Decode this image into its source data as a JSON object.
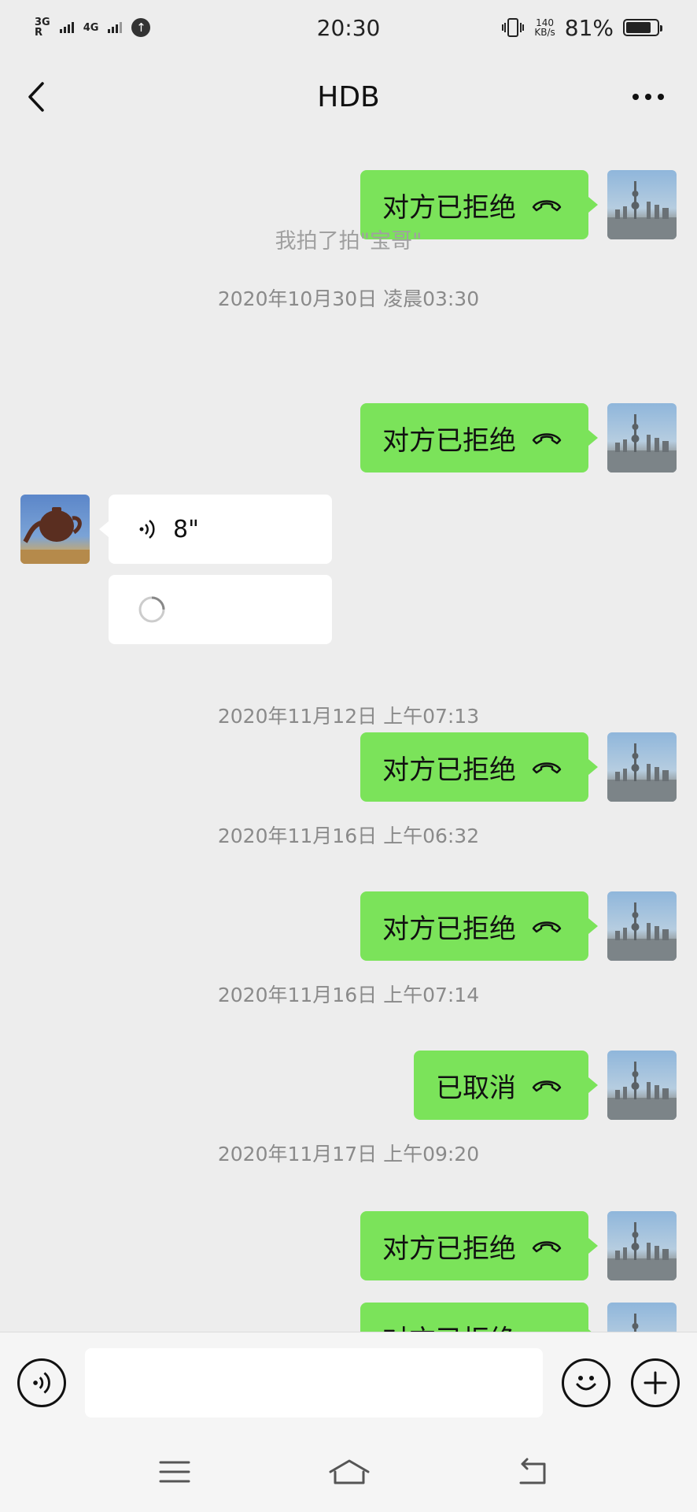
{
  "status_bar": {
    "time": "20:30",
    "network_1": "3G",
    "network_1_sub": "R",
    "network_2": "4G",
    "speed_value": "140",
    "speed_unit": "KB/s",
    "battery_text": "81%",
    "battery_level": 0.81
  },
  "header": {
    "title": "HDB",
    "back_icon": "chevron-left-icon",
    "more_icon": "more-dots-icon"
  },
  "messages": {
    "m1": {
      "text": "对方已拒绝",
      "icon": "phone-hangup-icon"
    },
    "note1": "我拍了拍\"宝哥\"",
    "ts1": "2020年10月30日 凌晨03:30",
    "m2": {
      "text": "对方已拒绝",
      "icon": "phone-hangup-icon"
    },
    "voice": {
      "duration": "8\"",
      "icon": "voice-wave-icon"
    },
    "ts2": "2020年11月12日 上午07:13",
    "m3": {
      "text": "对方已拒绝",
      "icon": "phone-hangup-icon"
    },
    "ts3": "2020年11月16日 上午06:32",
    "m4": {
      "text": "对方已拒绝",
      "icon": "phone-hangup-icon"
    },
    "ts4": "2020年11月16日 上午07:14",
    "m5": {
      "text": "已取消",
      "icon": "phone-hangup-icon"
    },
    "ts5": "2020年11月17日 上午09:20",
    "m6": {
      "text": "对方已拒绝",
      "icon": "phone-hangup-icon"
    },
    "m7": {
      "text": "对方已拒绝",
      "icon": "phone-hangup-icon"
    }
  },
  "input_bar": {
    "voice_icon": "voice-toggle-icon",
    "input_value": "",
    "emoji_icon": "emoji-icon",
    "plus_icon": "plus-icon"
  },
  "system_nav": {
    "menu_icon": "menu-icon",
    "home_icon": "home-icon",
    "back_icon": "back-icon"
  },
  "colors": {
    "bubble_out": "#95ec69",
    "background": "#ededed"
  }
}
